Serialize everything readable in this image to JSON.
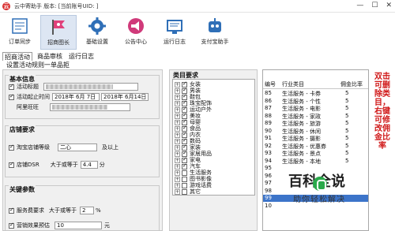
{
  "window": {
    "title": "云中寄助手 版本: [当前账号UID: ]",
    "controls": [
      "—",
      "☐",
      "✕"
    ]
  },
  "toolbar": {
    "items": [
      {
        "label": "订单同步",
        "icon": "sync-icon"
      },
      {
        "label": "招商图长",
        "icon": "flag-icon"
      },
      {
        "label": "基础设置",
        "icon": "gear-icon"
      },
      {
        "label": "公告中心",
        "icon": "megaphone-icon"
      },
      {
        "label": "运行日志",
        "icon": "log-icon"
      },
      {
        "label": "支付宝助手",
        "icon": "robot-icon"
      }
    ],
    "active_index": 1
  },
  "tabs": [
    "招商活动",
    "商品审核",
    "运行日志"
  ],
  "subtitle": "设置活动规则一单品拒",
  "basic": {
    "title": "基本信息",
    "name_label": "活动标题",
    "time_label": "活动起止时间",
    "start": "2018年 6月 7日",
    "end": "2018年 6月14日",
    "wangwang_label": "阿里旺旺"
  },
  "shop": {
    "title": "店铺要求",
    "level_label": "淘宝店铺等级",
    "level_value": "二心",
    "level_suffix": "及以上",
    "dsr_label": "店铺DSR",
    "dsr_mid": "大于或等于",
    "dsr_value": "4.4",
    "dsr_unit": "分"
  },
  "keyparams": {
    "title": "关键参数",
    "fee_label": "服务费要求",
    "fee_mid": "大于或等于",
    "fee_value": "2",
    "fee_unit": "%",
    "forecast_label": "营销效果预估",
    "forecast_value": "10",
    "forecast_unit": "元"
  },
  "category": {
    "title": "类目要求",
    "items": [
      {
        "label": "女装",
        "checked": true,
        "expand": true
      },
      {
        "label": "男装",
        "checked": true,
        "expand": true
      },
      {
        "label": "鞋包",
        "checked": true,
        "expand": true
      },
      {
        "label": "珠宝配饰",
        "checked": true,
        "expand": true
      },
      {
        "label": "运动户外",
        "checked": true,
        "expand": true
      },
      {
        "label": "美妆",
        "checked": true,
        "expand": true
      },
      {
        "label": "母婴",
        "checked": true,
        "expand": true
      },
      {
        "label": "食品",
        "checked": true,
        "expand": true
      },
      {
        "label": "内衣",
        "checked": true,
        "expand": true
      },
      {
        "label": "数码",
        "checked": true,
        "expand": true
      },
      {
        "label": "家装",
        "checked": true,
        "expand": true
      },
      {
        "label": "家居用品",
        "checked": true,
        "expand": true
      },
      {
        "label": "家电",
        "checked": true,
        "expand": true
      },
      {
        "label": "汽车",
        "checked": true,
        "expand": true
      },
      {
        "label": "生活服务",
        "checked": false,
        "expand": true
      },
      {
        "label": "图书影像",
        "checked": false,
        "expand": true
      },
      {
        "label": "游戏话费",
        "checked": false,
        "expand": true
      },
      {
        "label": "其它",
        "checked": false,
        "expand": true
      }
    ]
  },
  "table": {
    "headers": [
      "编号",
      "行业类目",
      "佣金比率"
    ],
    "rows": [
      {
        "id": "85",
        "cat": "生活服务 - 卡券",
        "rate": "5"
      },
      {
        "id": "86",
        "cat": "生活服务 - 个性",
        "rate": "5"
      },
      {
        "id": "87",
        "cat": "生活服务 - 电影",
        "rate": "5"
      },
      {
        "id": "88",
        "cat": "生活服务 - 家政",
        "rate": "5"
      },
      {
        "id": "89",
        "cat": "生活服务 - 旅游",
        "rate": "5"
      },
      {
        "id": "90",
        "cat": "生活服务 - 休闲",
        "rate": "5"
      },
      {
        "id": "91",
        "cat": "生活服务 - 摄影",
        "rate": "5"
      },
      {
        "id": "92",
        "cat": "生活服务 - 优惠券",
        "rate": "5"
      },
      {
        "id": "93",
        "cat": "生活服务 - 景点",
        "rate": "5"
      },
      {
        "id": "94",
        "cat": "生活服务 - 本地",
        "rate": "5"
      },
      {
        "id": "95",
        "cat": "",
        "rate": ""
      },
      {
        "id": "96",
        "cat": "",
        "rate": ""
      },
      {
        "id": "97",
        "cat": "",
        "rate": ""
      },
      {
        "id": "98",
        "cat": "",
        "rate": ""
      },
      {
        "id": "99",
        "cat": "",
        "rate": ""
      },
      {
        "id": "10",
        "cat": "",
        "rate": ""
      }
    ],
    "selected_index": 14
  },
  "note": "双击可删除类目，右键可修改佣金比率",
  "watermark": {
    "title": "百科全说",
    "subtitle": "助你轻松解决"
  },
  "colors": {
    "accent": "#3c74c9",
    "note_red": "#d01818",
    "watermark_green": "#29a94a"
  }
}
